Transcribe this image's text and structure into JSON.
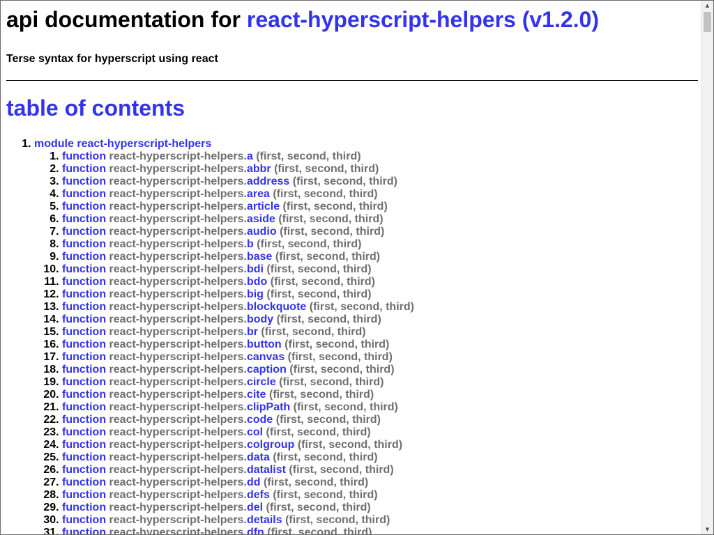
{
  "header": {
    "title_prefix": "api documentation for",
    "title_link": "react-hyperscript-helpers (v1.2.0)",
    "tagline": "Terse syntax for hyperscript using react"
  },
  "toc": {
    "title": "table of contents",
    "module_label": "module react-hyperscript-helpers",
    "keyword": "function",
    "namespace": "react-hyperscript-helpers.",
    "args": "(first, second, third)",
    "functions": [
      "a",
      "abbr",
      "address",
      "area",
      "article",
      "aside",
      "audio",
      "b",
      "base",
      "bdi",
      "bdo",
      "big",
      "blockquote",
      "body",
      "br",
      "button",
      "canvas",
      "caption",
      "circle",
      "cite",
      "clipPath",
      "code",
      "col",
      "colgroup",
      "data",
      "datalist",
      "dd",
      "defs",
      "del",
      "details",
      "dfn"
    ]
  },
  "colors": {
    "link": "#3333ee",
    "muted": "#6f6f6f"
  },
  "icons": {
    "scroll_up": "scroll-up-arrow-icon",
    "scroll_down": "scroll-down-arrow-icon"
  }
}
